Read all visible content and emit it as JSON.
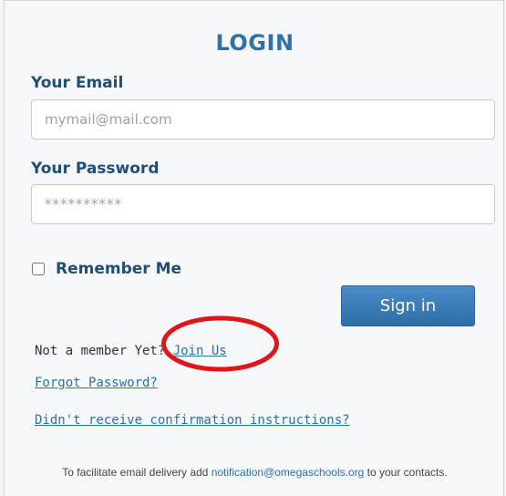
{
  "login": {
    "title": "LOGIN",
    "email_label": "Your Email",
    "email_placeholder": "mymail@mail.com",
    "password_label": "Your Password",
    "password_placeholder": "**********",
    "remember_label": "Remember Me",
    "remember_checked": false,
    "sign_in_label": "Sign in",
    "not_member_text": "Not a member Yet?",
    "join_link": "Join Us",
    "forgot_link": "Forgot Password?",
    "confirmation_link": "Didn't receive confirmation instructions?"
  },
  "footer": {
    "text_before": "To facilitate email delivery add",
    "email": "notification@omegaschools.org",
    "text_after": "to your contacts."
  },
  "annotation": {
    "color": "#e0161b"
  }
}
